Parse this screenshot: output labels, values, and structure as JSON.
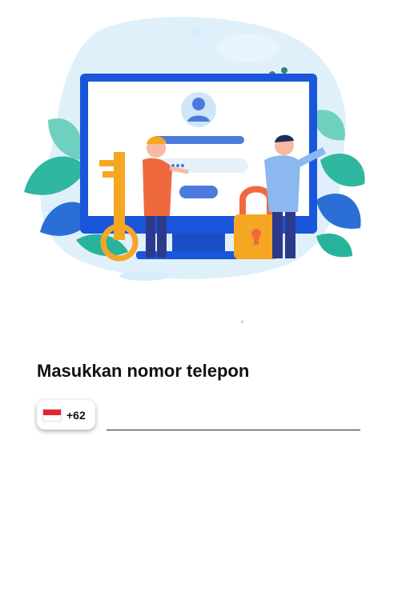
{
  "illustration": {
    "name": "login-illustration"
  },
  "tiny_mark": "ᵛ",
  "title": "Masukkan nomor telepon",
  "phone": {
    "country_flag": "indonesia-flag-icon",
    "country_code": "+62",
    "value": "",
    "placeholder": ""
  },
  "colors": {
    "monitor_blue": "#1a56db",
    "blob_light": "#dff0fb",
    "accent_orange": "#f5a623",
    "flag_red": "#e3262f"
  }
}
